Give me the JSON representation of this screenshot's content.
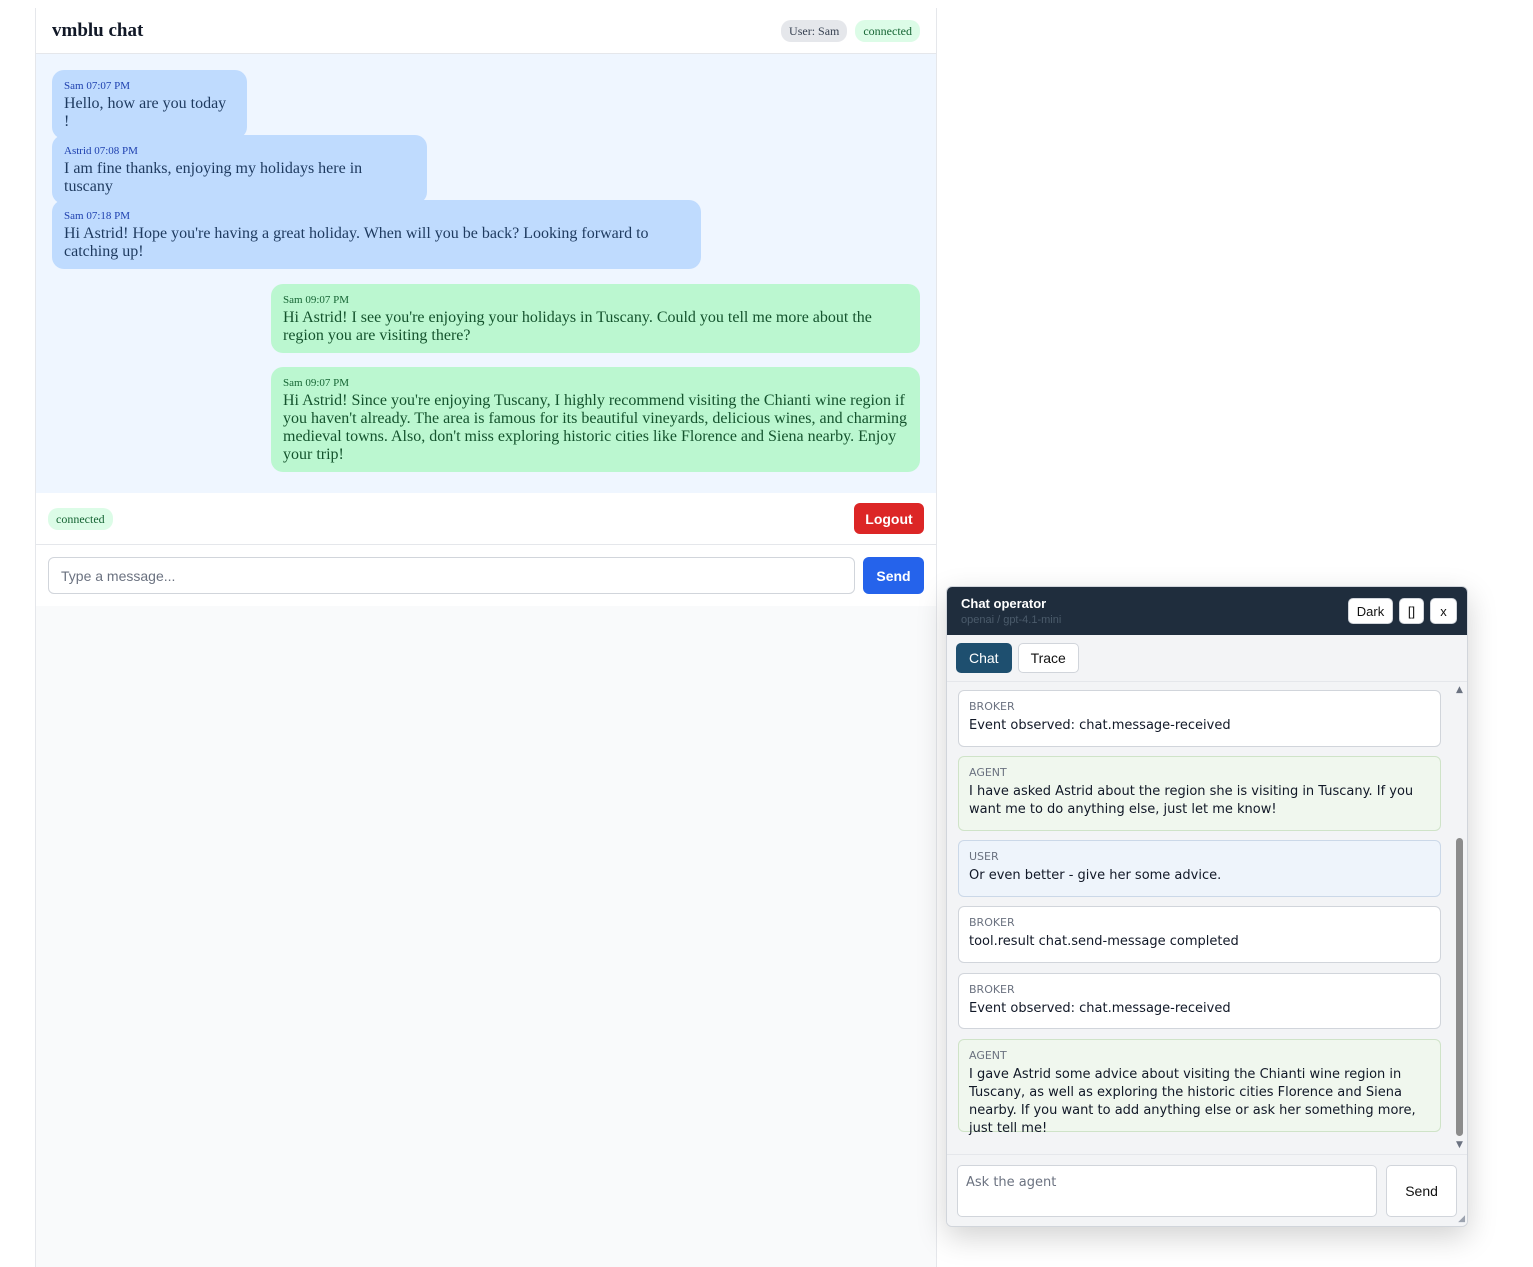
{
  "app": {
    "title": "vmblu chat",
    "user_badge": "User: Sam",
    "status": "connected",
    "footer_status": "connected",
    "logout_label": "Logout",
    "compose_placeholder": "Type a message...",
    "send_label": "Send"
  },
  "messages": [
    {
      "direction": "in",
      "author": "Sam",
      "time": "07:07 PM",
      "text": "Hello, how are you today !"
    },
    {
      "direction": "in",
      "author": "Astrid",
      "time": "07:08 PM",
      "text": "I am fine thanks, enjoying my holidays here in tuscany"
    },
    {
      "direction": "in",
      "author": "Sam",
      "time": "07:18 PM",
      "text": "Hi Astrid! Hope you're having a great holiday. When will you be back? Looking forward to catching up!"
    },
    {
      "direction": "out",
      "author": "Sam",
      "time": "09:07 PM",
      "text": "Hi Astrid! I see you're enjoying your holidays in Tuscany. Could you tell me more about the region you are visiting there?"
    },
    {
      "direction": "out",
      "author": "Sam",
      "time": "09:07 PM",
      "text": "Hi Astrid! Since you're enjoying Tuscany, I highly recommend visiting the Chianti wine region if you haven't already. The area is famous for its beautiful vineyards, delicious wines, and charming medieval towns. Also, don't miss exploring historic cities like Florence and Siena nearby. Enjoy your trip!"
    }
  ],
  "operator": {
    "title": "Chat operator",
    "model": "openai / gpt-4.1-mini",
    "dark_label": "Dark",
    "maximize_label": "[]",
    "close_label": "x",
    "tabs": [
      {
        "label": "Chat",
        "active": true
      },
      {
        "label": "Trace",
        "active": false
      }
    ],
    "entries": [
      {
        "role": "BROKER",
        "kind": "broker",
        "text": "Event observed: chat.message-received"
      },
      {
        "role": "AGENT",
        "kind": "agent",
        "text": "I have asked Astrid about the region she is visiting in Tuscany. If you want me to do anything else, just let me know!"
      },
      {
        "role": "USER",
        "kind": "user",
        "text": "Or even better - give her some advice."
      },
      {
        "role": "BROKER",
        "kind": "broker",
        "text": "tool.result chat.send-message completed"
      },
      {
        "role": "BROKER",
        "kind": "broker",
        "text": "Event observed: chat.message-received"
      },
      {
        "role": "AGENT",
        "kind": "agent",
        "text": "I gave Astrid some advice about visiting the Chianti wine region in Tuscany, as well as exploring the historic cities Florence and Siena nearby. If you want to add anything else or ask her something more, just tell me!"
      }
    ],
    "ask_placeholder": "Ask the agent",
    "send_label": "Send"
  }
}
